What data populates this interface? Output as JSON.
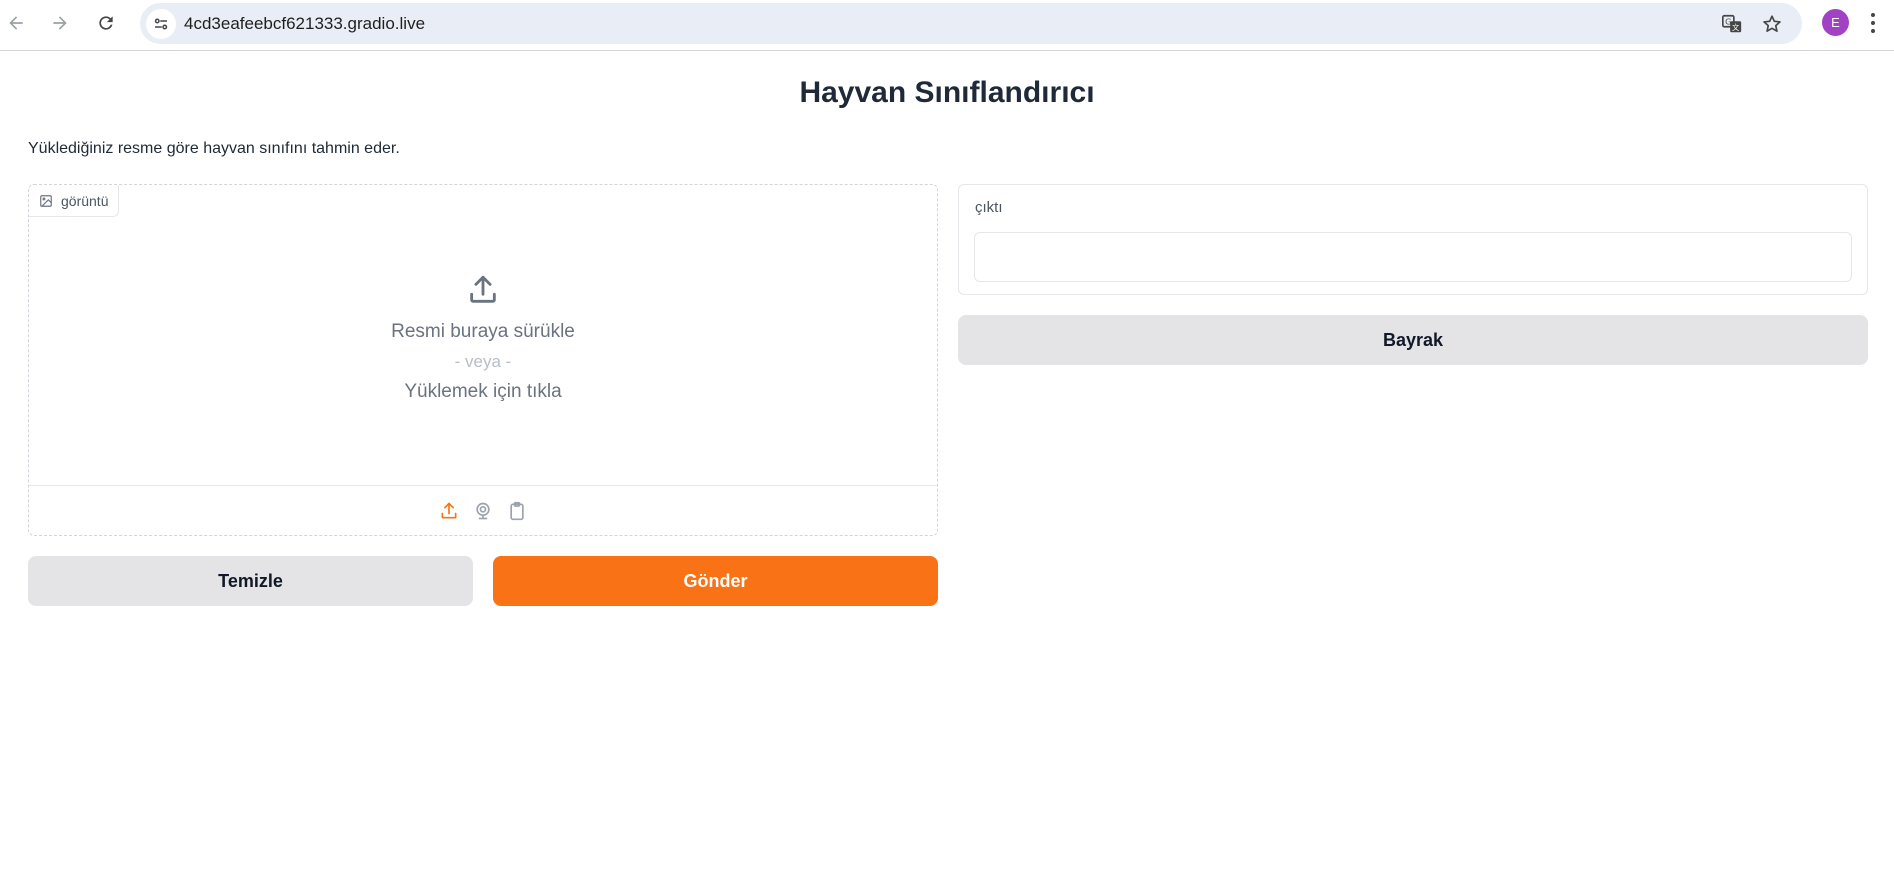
{
  "browser": {
    "url": "4cd3eafeebcf621333.gradio.live",
    "profile_initial": "E",
    "icons": {
      "back": "arrow-left-icon",
      "forward": "arrow-right-icon",
      "reload": "reload-icon",
      "site_info": "tune-icon",
      "translate": "translate-icon",
      "bookmark": "star-icon",
      "menu": "three-dots-vertical-icon"
    }
  },
  "app": {
    "title": "Hayvan Sınıflandırıcı",
    "description": "Yüklediğiniz resme göre hayvan sınıfını tahmin eder.",
    "input": {
      "label": "görüntü",
      "drop_text": "Resmi buraya sürükle",
      "or_text": "- veya -",
      "click_text": "Yüklemek için tıkla",
      "sources": [
        "upload-icon",
        "webcam-icon",
        "clipboard-icon"
      ],
      "active_source": "upload-icon"
    },
    "buttons": {
      "clear": "Temizle",
      "submit": "Gönder",
      "flag": "Bayrak"
    },
    "output": {
      "label": "çıktı",
      "value": ""
    }
  },
  "colors": {
    "primary": "#f97316",
    "secondary": "#e4e4e7",
    "avatar": "#a142c4",
    "omnibox": "#e9eef6"
  }
}
